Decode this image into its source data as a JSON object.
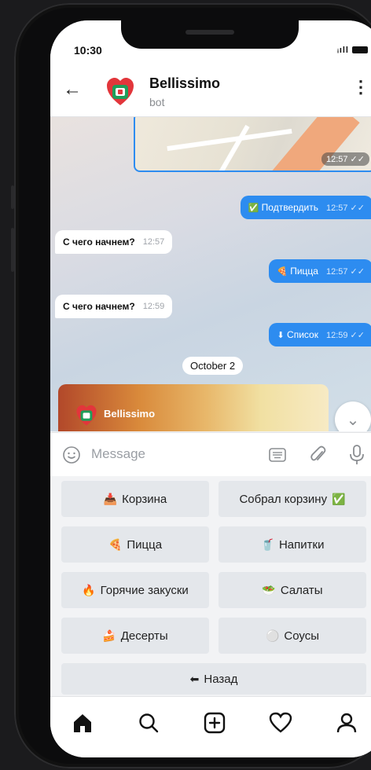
{
  "status_bar": {
    "time": "10:30",
    "signal": "ᵢıll"
  },
  "chat_header": {
    "title": "Bellissimo",
    "subtitle": "bot"
  },
  "messages": {
    "map_time": "12:57 ✓✓",
    "confirm": {
      "icon": "✅",
      "text": "Подтвердить",
      "time": "12:57 ✓✓"
    },
    "q1": {
      "text": "С чего начнем?",
      "time": "12:57"
    },
    "pizza": {
      "icon": "🍕",
      "text": "Пицца",
      "time": "12:57 ✓✓"
    },
    "q2": {
      "text": "С чего начнем?",
      "time": "12:59"
    },
    "list": {
      "icon": "⬇",
      "text": "Список",
      "time": "12:59 ✓✓"
    },
    "date": "October 2",
    "photo_brand": "Bellissimo"
  },
  "input": {
    "placeholder": "Message"
  },
  "keyboard": {
    "cart": {
      "icon": "📥",
      "label": "Корзина"
    },
    "cart_done": {
      "label": "Собрал корзину",
      "icon": "✅"
    },
    "pizza": {
      "icon": "🍕",
      "label": "Пицца"
    },
    "drinks": {
      "icon": "🥤",
      "label": "Напитки"
    },
    "hot": {
      "icon": "🔥",
      "label": "Горячие закуски"
    },
    "salads": {
      "icon": "🥗",
      "label": "Салаты"
    },
    "desserts": {
      "icon": "🍰",
      "label": "Десерты"
    },
    "sauces": {
      "icon": "⚪",
      "label": "Соусы"
    },
    "back": {
      "icon": "⬅",
      "label": "Назад"
    }
  },
  "colors": {
    "accent": "#2d8cf0",
    "brand_red": "#e2363b",
    "brand_green": "#1f9e5a"
  }
}
